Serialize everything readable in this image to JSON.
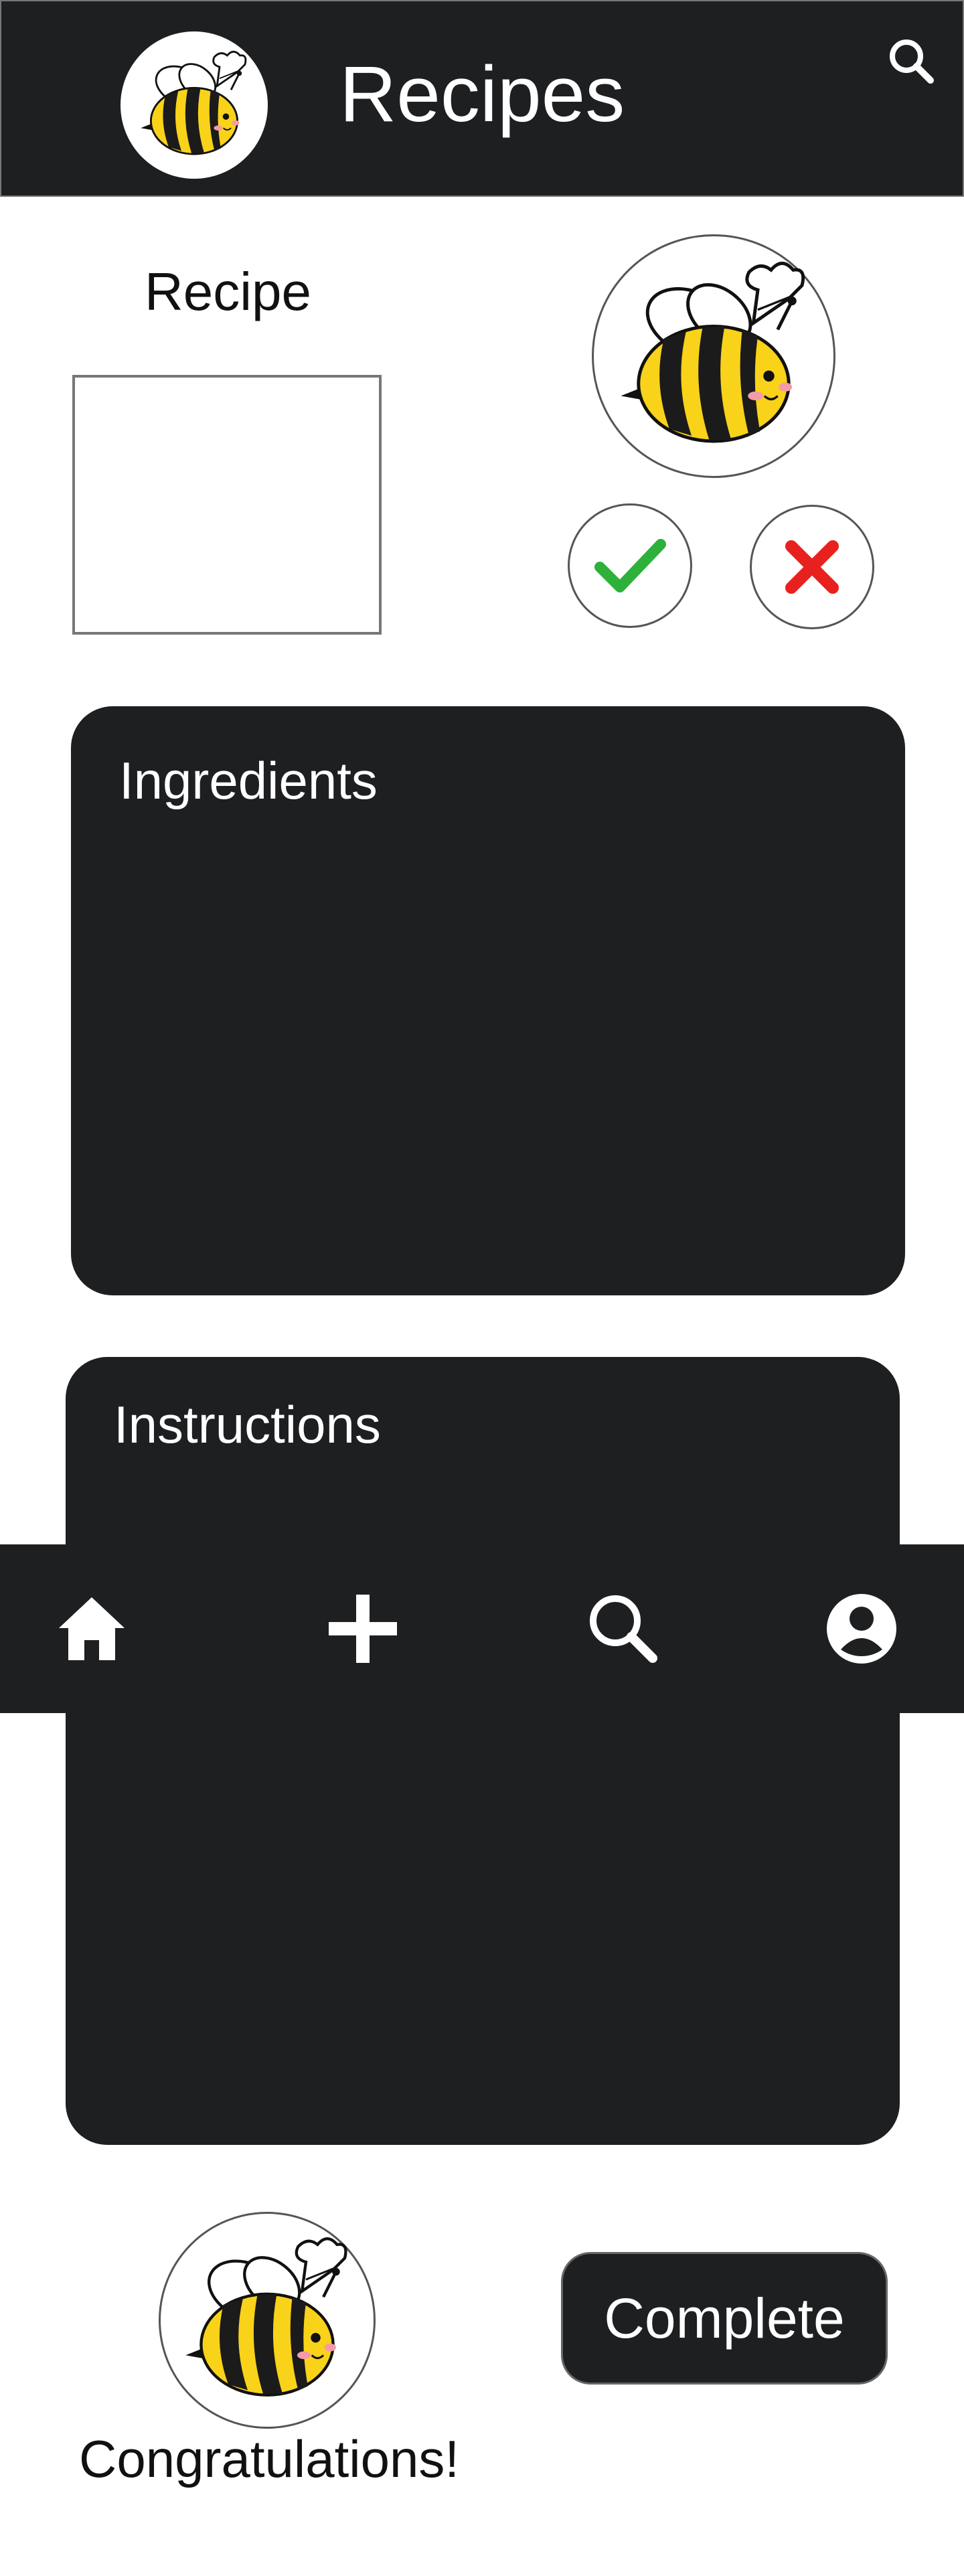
{
  "header": {
    "title": "Recipes",
    "logo_icon": "bee-chef-icon",
    "search_icon": "search-icon"
  },
  "recipe": {
    "label": "Recipe"
  },
  "actions": {
    "accept_icon": "check-icon",
    "reject_icon": "close-icon",
    "accept_color": "#2db13a",
    "reject_color": "#e8211e"
  },
  "ingredients": {
    "title": "Ingredients"
  },
  "instructions": {
    "title": "Instructions"
  },
  "nav": {
    "items": [
      "home-icon",
      "plus-icon",
      "search-icon",
      "profile-icon"
    ]
  },
  "footer": {
    "congrats": "Congratulations!",
    "complete_label": "Complete"
  },
  "colors": {
    "dark": "#1e1f21",
    "bee_yellow": "#f9d21a",
    "bee_stripe": "#1b1b1b"
  }
}
